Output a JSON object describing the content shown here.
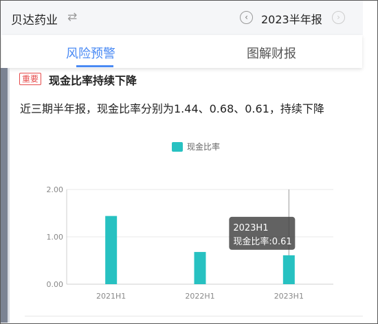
{
  "header": {
    "company": "贝达药业",
    "swap_icon": "swap-arrows-icon",
    "prev_icon": "chevron-left-circle-icon",
    "period": "2023半年报",
    "next_icon": "chevron-right-circle-icon"
  },
  "tabs": [
    {
      "label": "风险预警",
      "active": true
    },
    {
      "label": "图解财报",
      "active": false
    }
  ],
  "alert": {
    "badge": "重要",
    "title": "现金比率持续下降",
    "description": "近三期半年报，现金比率分别为1.44、0.68、0.61，持续下降"
  },
  "colors": {
    "accent": "#4a8af4",
    "bar": "#27c1c1",
    "badge": "#e64b4b"
  },
  "tooltip": {
    "title": "2023H1",
    "label": "现金比率:0.61"
  },
  "chart_data": {
    "type": "bar",
    "categories": [
      "2021H1",
      "2022H1",
      "2023H1"
    ],
    "series": [
      {
        "name": "现金比率",
        "values": [
          1.44,
          0.68,
          0.61
        ]
      }
    ],
    "ylim": [
      0,
      2
    ],
    "yticks": [
      "0.00",
      "1.00",
      "2.00"
    ],
    "legend": "top-center",
    "grid": true,
    "highlighted_category": "2023H1"
  }
}
